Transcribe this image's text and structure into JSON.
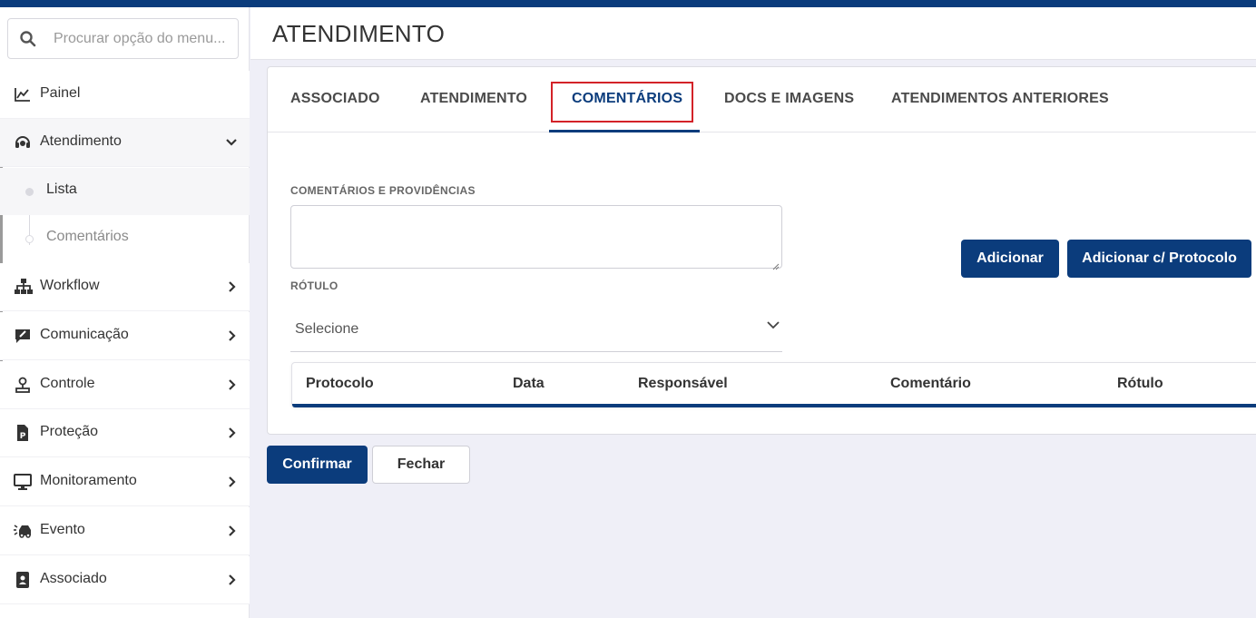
{
  "colors": {
    "accent": "#0b3c7c",
    "highlight": "#d32228"
  },
  "search": {
    "placeholder": "Procurar opção do menu..."
  },
  "sidebar": {
    "items": [
      {
        "label": "Painel",
        "icon": "chart-line-icon"
      },
      {
        "label": "Atendimento",
        "icon": "headset-icon",
        "expanded": true,
        "children": [
          {
            "label": "Lista",
            "active": true
          },
          {
            "label": "Comentários",
            "active": false
          }
        ]
      },
      {
        "label": "Workflow",
        "icon": "sitemap-icon"
      },
      {
        "label": "Comunicação",
        "icon": "comment-edit-icon"
      },
      {
        "label": "Controle",
        "icon": "user-control-icon"
      },
      {
        "label": "Proteção",
        "icon": "file-p-icon"
      },
      {
        "label": "Monitoramento",
        "icon": "monitor-icon"
      },
      {
        "label": "Evento",
        "icon": "car-crash-icon"
      },
      {
        "label": "Associado",
        "icon": "id-badge-icon"
      }
    ]
  },
  "header": {
    "title": "ATENDIMENTO"
  },
  "tabs": [
    {
      "label": "ASSOCIADO"
    },
    {
      "label": "ATENDIMENTO"
    },
    {
      "label": "COMENTÁRIOS",
      "active": true
    },
    {
      "label": "DOCS E IMAGENS"
    },
    {
      "label": "ATENDIMENTOS ANTERIORES"
    }
  ],
  "form": {
    "comments_label": "COMENTÁRIOS E PROVIDÊNCIAS",
    "comments_value": "",
    "label_label": "RÓTULO",
    "label_value": "Selecione",
    "add_button": "Adicionar",
    "add_protocol_button": "Adicionar c/ Protocolo"
  },
  "table": {
    "columns": [
      "Protocolo",
      "Data",
      "Responsável",
      "Comentário",
      "Rótulo"
    ]
  },
  "footer": {
    "confirm": "Confirmar",
    "close": "Fechar"
  }
}
